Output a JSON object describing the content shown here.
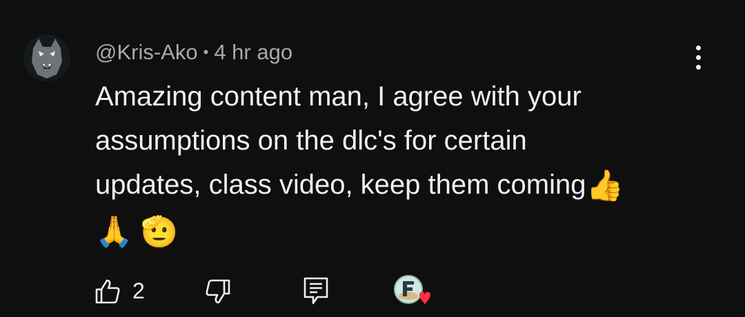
{
  "comment": {
    "author": "@Kris-Ako",
    "separator": "•",
    "time": "4 hr ago",
    "lines": [
      "Amazing content man, I agree with your",
      "assumptions on the dlc's for certain",
      "updates, class video, keep them coming"
    ],
    "emoji_thumbs": "👍",
    "emoji_pray": "🙏",
    "emoji_salute": "🫡"
  },
  "actions": {
    "like_count": "2"
  },
  "colors": {
    "background": "#0f0f0f",
    "text": "#f1f1f1",
    "meta": "#aaaaaa",
    "heart": "#ff2e43"
  }
}
